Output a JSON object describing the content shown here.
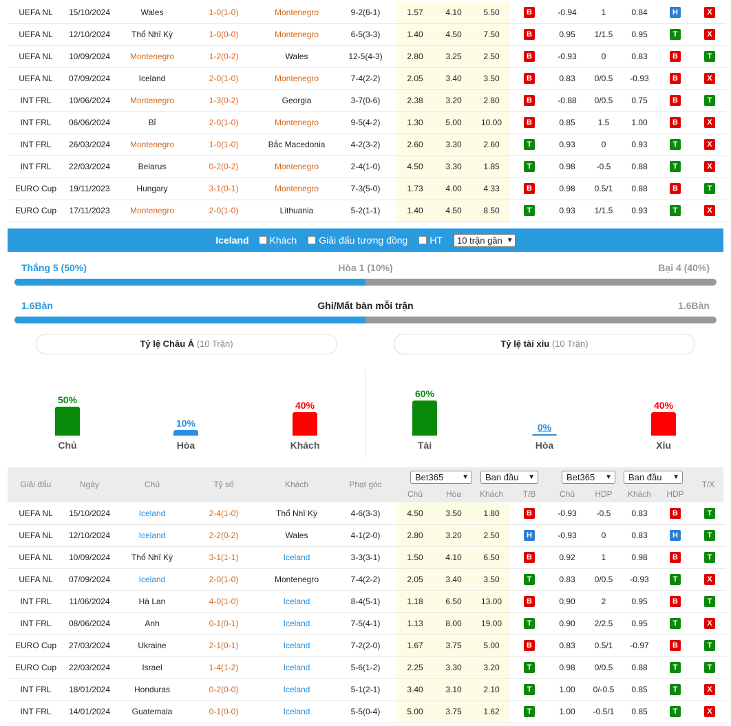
{
  "top_table": {
    "rows": [
      {
        "league": "UEFA NL",
        "date": "15/10/2024",
        "home": "Wales",
        "score": "1-0(1-0)",
        "away": "Montenegro",
        "corner": "9-2(6-1)",
        "o1": "1.57",
        "o2": "4.10",
        "o3": "5.50",
        "r1": "B",
        "hdp1": "-0.94",
        "hdp": "1",
        "hdp2": "0.84",
        "r2": "H",
        "r3": "X",
        "hl": "away"
      },
      {
        "league": "UEFA NL",
        "date": "12/10/2024",
        "home": "Thổ Nhĩ Kỳ",
        "score": "1-0(0-0)",
        "away": "Montenegro",
        "corner": "6-5(3-3)",
        "o1": "1.40",
        "o2": "4.50",
        "o3": "7.50",
        "r1": "B",
        "hdp1": "0.95",
        "hdp": "1/1.5",
        "hdp2": "0.95",
        "r2": "T",
        "r3": "X",
        "hl": "away"
      },
      {
        "league": "UEFA NL",
        "date": "10/09/2024",
        "home": "Montenegro",
        "score": "1-2(0-2)",
        "away": "Wales",
        "corner": "12-5(4-3)",
        "o1": "2.80",
        "o2": "3.25",
        "o3": "2.50",
        "r1": "B",
        "hdp1": "-0.93",
        "hdp": "0",
        "hdp2": "0.83",
        "r2": "B",
        "r3": "T",
        "hl": "home"
      },
      {
        "league": "UEFA NL",
        "date": "07/09/2024",
        "home": "Iceland",
        "score": "2-0(1-0)",
        "away": "Montenegro",
        "corner": "7-4(2-2)",
        "o1": "2.05",
        "o2": "3.40",
        "o3": "3.50",
        "r1": "B",
        "hdp1": "0.83",
        "hdp": "0/0.5",
        "hdp2": "-0.93",
        "r2": "B",
        "r3": "X",
        "hl": "away"
      },
      {
        "league": "INT FRL",
        "date": "10/06/2024",
        "home": "Montenegro",
        "score": "1-3(0-2)",
        "away": "Georgia",
        "corner": "3-7(0-6)",
        "o1": "2.38",
        "o2": "3.20",
        "o3": "2.80",
        "r1": "B",
        "hdp1": "-0.88",
        "hdp": "0/0.5",
        "hdp2": "0.75",
        "r2": "B",
        "r3": "T",
        "hl": "home"
      },
      {
        "league": "INT FRL",
        "date": "06/06/2024",
        "home": "Bỉ",
        "score": "2-0(1-0)",
        "away": "Montenegro",
        "corner": "9-5(4-2)",
        "o1": "1.30",
        "o2": "5.00",
        "o3": "10.00",
        "r1": "B",
        "hdp1": "0.85",
        "hdp": "1.5",
        "hdp2": "1.00",
        "r2": "B",
        "r3": "X",
        "hl": "away"
      },
      {
        "league": "INT FRL",
        "date": "26/03/2024",
        "home": "Montenegro",
        "score": "1-0(1-0)",
        "away": "Bắc Macedonia",
        "corner": "4-2(3-2)",
        "o1": "2.60",
        "o2": "3.30",
        "o3": "2.60",
        "r1": "T",
        "hdp1": "0.93",
        "hdp": "0",
        "hdp2": "0.93",
        "r2": "T",
        "r3": "X",
        "hl": "home"
      },
      {
        "league": "INT FRL",
        "date": "22/03/2024",
        "home": "Belarus",
        "score": "0-2(0-2)",
        "away": "Montenegro",
        "corner": "2-4(1-0)",
        "o1": "4.50",
        "o2": "3.30",
        "o3": "1.85",
        "r1": "T",
        "hdp1": "0.98",
        "hdp": "-0.5",
        "hdp2": "0.88",
        "r2": "T",
        "r3": "X",
        "hl": "away"
      },
      {
        "league": "EURO Cup",
        "date": "19/11/2023",
        "home": "Hungary",
        "score": "3-1(0-1)",
        "away": "Montenegro",
        "corner": "7-3(5-0)",
        "o1": "1.73",
        "o2": "4.00",
        "o3": "4.33",
        "r1": "B",
        "hdp1": "0.98",
        "hdp": "0.5/1",
        "hdp2": "0.88",
        "r2": "B",
        "r3": "T",
        "hl": "away"
      },
      {
        "league": "EURO Cup",
        "date": "17/11/2023",
        "home": "Montenegro",
        "score": "2-0(1-0)",
        "away": "Lithuania",
        "corner": "5-2(1-1)",
        "o1": "1.40",
        "o2": "4.50",
        "o3": "8.50",
        "r1": "T",
        "hdp1": "0.93",
        "hdp": "1/1.5",
        "hdp2": "0.93",
        "r2": "T",
        "r3": "X",
        "hl": "home"
      }
    ]
  },
  "filter": {
    "team": "Iceland",
    "away_label": "Khách",
    "same_league_label": "Giải đấu tương đồng",
    "ht_label": "HT",
    "recent_select": "10 trận gần"
  },
  "summary": {
    "win": "Thắng 5 (50%)",
    "draw": "Hòa 1 (10%)",
    "loss": "Bại 4 (40%)",
    "win_fraction": 0.5,
    "goals_for": "1.6Bàn",
    "goals_title": "Ghi/Mất bàn mỗi trận",
    "goals_against": "1.6Bàn",
    "goals_fraction": 0.5
  },
  "asian": {
    "title": "Tỷ lệ Châu Á",
    "sub": "(10 Trận)",
    "items": [
      {
        "pct": "50%",
        "label": "Chủ",
        "value": 50,
        "color": "#0a8a0a"
      },
      {
        "pct": "10%",
        "label": "Hòa",
        "value": 10,
        "color": "#2b8ee0"
      },
      {
        "pct": "40%",
        "label": "Khách",
        "value": 40,
        "color": "#ff0000"
      }
    ]
  },
  "overunder": {
    "title": "Tỷ lệ tài xỉu",
    "sub": "(10 Trận)",
    "items": [
      {
        "pct": "60%",
        "label": "Tài",
        "value": 60,
        "color": "#0a8a0a"
      },
      {
        "pct": "0%",
        "label": "Hòa",
        "value": 0,
        "color": "#2b8ee0"
      },
      {
        "pct": "40%",
        "label": "Xỉu",
        "value": 40,
        "color": "#ff0000"
      }
    ]
  },
  "header": {
    "league": "Giải đấu",
    "date": "Ngày",
    "home": "Chủ",
    "score": "Tỷ số",
    "away": "Khách",
    "corner": "Phạt góc",
    "book1": "Bet365",
    "type1": "Ban đầu",
    "book2": "Bet365",
    "type2": "Ban đầu",
    "o_home": "Chủ",
    "o_draw": "Hòa",
    "o_away": "Khách",
    "tb": "T/B",
    "h_home": "Chủ",
    "hdp": "HDP",
    "h_away": "Khách",
    "hdp2": "HDP",
    "tx": "T/X"
  },
  "bottom_table": {
    "rows": [
      {
        "league": "UEFA NL",
        "date": "15/10/2024",
        "home": "Iceland",
        "score": "2-4(1-0)",
        "away": "Thổ Nhĩ Kỳ",
        "corner": "4-6(3-3)",
        "o1": "4.50",
        "o2": "3.50",
        "o3": "1.80",
        "r1": "B",
        "hdp1": "-0.93",
        "hdp": "-0.5",
        "hdp2": "0.83",
        "r2": "B",
        "r3": "T",
        "hl": "home"
      },
      {
        "league": "UEFA NL",
        "date": "12/10/2024",
        "home": "Iceland",
        "score": "2-2(0-2)",
        "away": "Wales",
        "corner": "4-1(2-0)",
        "o1": "2.80",
        "o2": "3.20",
        "o3": "2.50",
        "r1": "H",
        "hdp1": "-0.93",
        "hdp": "0",
        "hdp2": "0.83",
        "r2": "H",
        "r3": "T",
        "hl": "home"
      },
      {
        "league": "UEFA NL",
        "date": "10/09/2024",
        "home": "Thổ Nhĩ Kỳ",
        "score": "3-1(1-1)",
        "away": "Iceland",
        "corner": "3-3(3-1)",
        "o1": "1.50",
        "o2": "4.10",
        "o3": "6.50",
        "r1": "B",
        "hdp1": "0.92",
        "hdp": "1",
        "hdp2": "0.98",
        "r2": "B",
        "r3": "T",
        "hl": "away"
      },
      {
        "league": "UEFA NL",
        "date": "07/09/2024",
        "home": "Iceland",
        "score": "2-0(1-0)",
        "away": "Montenegro",
        "corner": "7-4(2-2)",
        "o1": "2.05",
        "o2": "3.40",
        "o3": "3.50",
        "r1": "T",
        "hdp1": "0.83",
        "hdp": "0/0.5",
        "hdp2": "-0.93",
        "r2": "T",
        "r3": "X",
        "hl": "home"
      },
      {
        "league": "INT FRL",
        "date": "11/06/2024",
        "home": "Hà Lan",
        "score": "4-0(1-0)",
        "away": "Iceland",
        "corner": "8-4(5-1)",
        "o1": "1.18",
        "o2": "6.50",
        "o3": "13.00",
        "r1": "B",
        "hdp1": "0.90",
        "hdp": "2",
        "hdp2": "0.95",
        "r2": "B",
        "r3": "T",
        "hl": "away"
      },
      {
        "league": "INT FRL",
        "date": "08/06/2024",
        "home": "Anh",
        "score": "0-1(0-1)",
        "away": "Iceland",
        "corner": "7-5(4-1)",
        "o1": "1.13",
        "o2": "8.00",
        "o3": "19.00",
        "r1": "T",
        "hdp1": "0.90",
        "hdp": "2/2.5",
        "hdp2": "0.95",
        "r2": "T",
        "r3": "X",
        "hl": "away"
      },
      {
        "league": "EURO Cup",
        "date": "27/03/2024",
        "home": "Ukraine",
        "score": "2-1(0-1)",
        "away": "Iceland",
        "corner": "7-2(2-0)",
        "o1": "1.67",
        "o2": "3.75",
        "o3": "5.00",
        "r1": "B",
        "hdp1": "0.83",
        "hdp": "0.5/1",
        "hdp2": "-0.97",
        "r2": "B",
        "r3": "T",
        "hl": "away"
      },
      {
        "league": "EURO Cup",
        "date": "22/03/2024",
        "home": "Israel",
        "score": "1-4(1-2)",
        "away": "Iceland",
        "corner": "5-6(1-2)",
        "o1": "2.25",
        "o2": "3.30",
        "o3": "3.20",
        "r1": "T",
        "hdp1": "0.98",
        "hdp": "0/0.5",
        "hdp2": "0.88",
        "r2": "T",
        "r3": "T",
        "hl": "away"
      },
      {
        "league": "INT FRL",
        "date": "18/01/2024",
        "home": "Honduras",
        "score": "0-2(0-0)",
        "away": "Iceland",
        "corner": "5-1(2-1)",
        "o1": "3.40",
        "o2": "3.10",
        "o3": "2.10",
        "r1": "T",
        "hdp1": "1.00",
        "hdp": "0/-0.5",
        "hdp2": "0.85",
        "r2": "T",
        "r3": "X",
        "hl": "away"
      },
      {
        "league": "INT FRL",
        "date": "14/01/2024",
        "home": "Guatemala",
        "score": "0-1(0-0)",
        "away": "Iceland",
        "corner": "5-5(0-4)",
        "o1": "5.00",
        "o2": "3.75",
        "o3": "1.62",
        "r1": "T",
        "hdp1": "1.00",
        "hdp": "-0.5/1",
        "hdp2": "0.85",
        "r2": "T",
        "r3": "X",
        "hl": "away"
      }
    ]
  },
  "colors": {
    "accent": "#2b9be0",
    "home_team_top": "#d2691e",
    "home_team_bottom": "#2a8bd6",
    "odds_bg": "#fdfde6",
    "win": "#0a8a0a",
    "loss": "#e00000",
    "draw": "#2a7fd4"
  }
}
